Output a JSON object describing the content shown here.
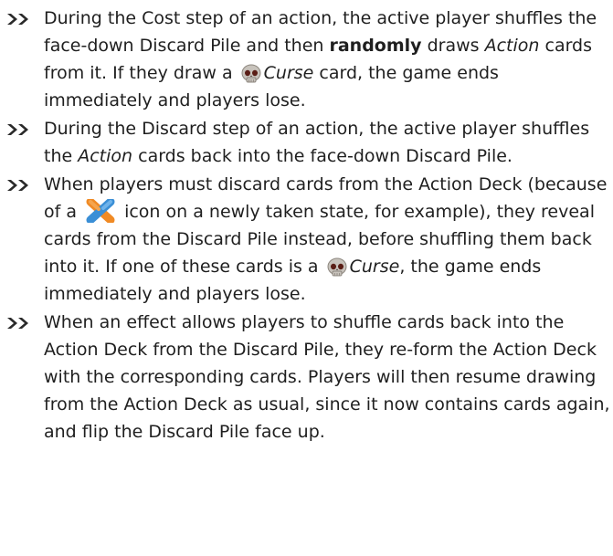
{
  "colors": {
    "bullet": "#2a2a2a",
    "text": "#1f1f1f",
    "skull": "#b9b4ad",
    "cross_blue": "#3a8fd6",
    "cross_orange": "#f08a24"
  },
  "icons": {
    "curse": "skull-icon",
    "discard": "discard-cross-icon",
    "bullet": "double-chevron-icon"
  },
  "rules": [
    {
      "p1": "During the Cost step of an action, the active player shuffles the face-down Discard Pile and then ",
      "bold": "randomly",
      "p2": " draws ",
      "italic1": "Action",
      "p3": " cards from it. If they draw a ",
      "italic2": "Curse",
      "p4": " card, the game ends immediately and players lose."
    },
    {
      "p1": "During the Discard step of an action, the active player shuffles the ",
      "italic1": "Action",
      "p2": " cards back into the face-down Discard Pile."
    },
    {
      "p1": "When players must discard cards from the Action Deck (because of a ",
      "p2": " icon on a newly taken state, for example), they reveal cards from the Discard Pile instead, before shuffling them back into it. If one of these cards is a ",
      "italic1": "Curse",
      "p3": ", the game ends immediately and players lose."
    },
    {
      "p1": "When an effect allows players to shuffle cards back into the Action Deck from the Discard Pile, they re-form the Action Deck with the corresponding cards. Players will then resume drawing from the Action Deck as usual, since it now contains cards again, and flip the Discard Pile face up."
    }
  ]
}
